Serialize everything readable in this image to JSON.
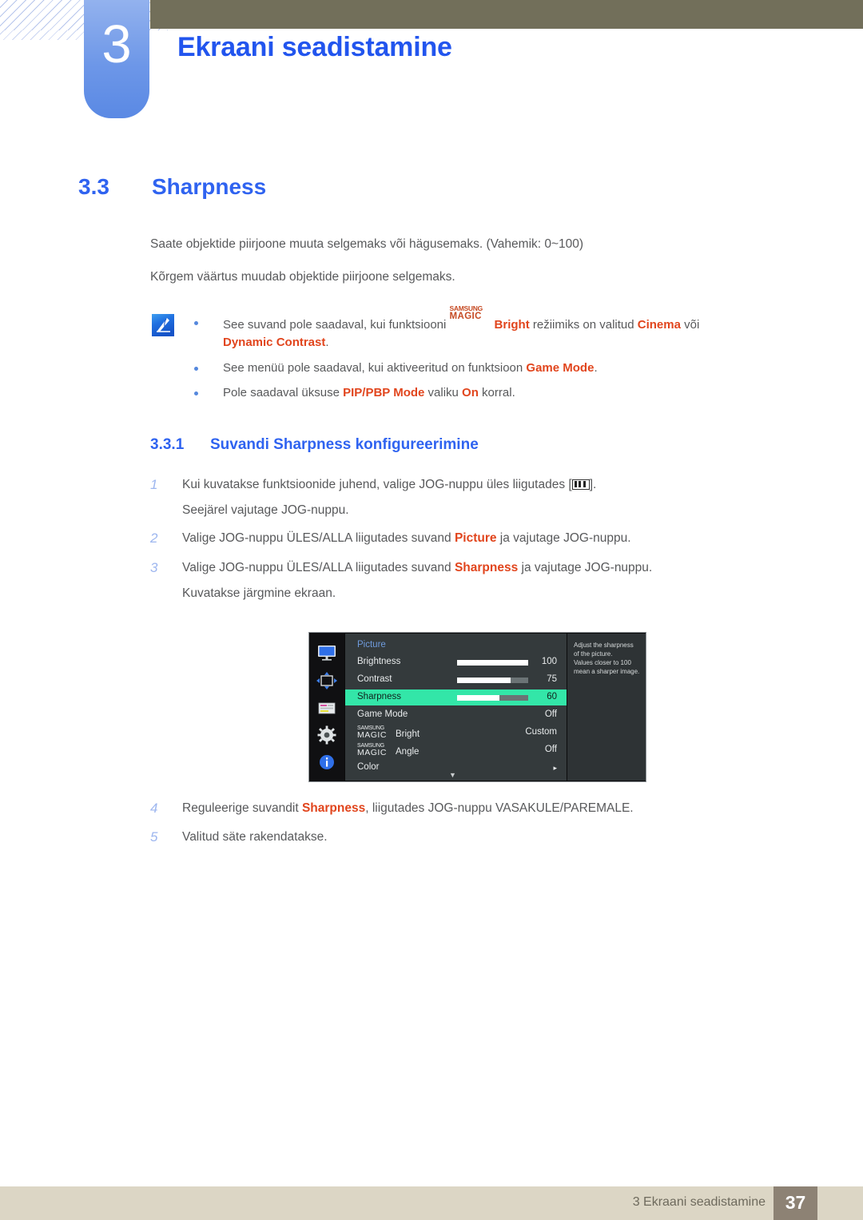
{
  "header": {
    "chapter_number": "3",
    "chapter_title": "Ekraani seadistamine"
  },
  "section": {
    "number": "3.3",
    "title": "Sharpness"
  },
  "intro": {
    "paragraph1": "Saate objektide piirjoone muuta selgemaks või hägusemaks. (Vahemik: 0~100)",
    "paragraph2": "Kõrgem väärtus muudab objektide piirjoone selgemaks."
  },
  "notes": [
    {
      "prefix": "See suvand pole saadaval, kui funktsiooni ",
      "magic_top": "SAMSUNG",
      "magic_bottom": "MAGIC",
      "magic_suffix": "Bright",
      "middle": " režiimiks on valitud ",
      "emphasis1": "Cinema",
      "conj": " või",
      "line2_emphasis": "Dynamic Contrast",
      "line2_tail": "."
    },
    {
      "prefix": "See menüü pole saadaval, kui aktiveeritud on funktsioon ",
      "emphasis1": "Game Mode",
      "tail": "."
    },
    {
      "prefix": "Pole saadaval üksuse ",
      "emphasis1": "PIP/PBP Mode",
      "middle": " valiku ",
      "emphasis2": "On",
      "tail": " korral."
    }
  ],
  "subsection": {
    "number": "3.3.1",
    "title": "Suvandi Sharpness konfigureerimine"
  },
  "steps": [
    {
      "num": "1",
      "text_before": "Kui kuvatakse funktsioonide juhend, valige JOG-nuppu üles liigutades [",
      "icon": "jog-up-icon",
      "text_after": "].",
      "sub": "Seejärel vajutage JOG-nuppu."
    },
    {
      "num": "2",
      "text_before": "Valige JOG-nuppu ÜLES/ALLA liigutades suvand ",
      "emphasis": "Picture",
      "text_after": " ja vajutage JOG-nuppu."
    },
    {
      "num": "3",
      "text_before": "Valige JOG-nuppu ÜLES/ALLA liigutades suvand ",
      "emphasis": "Sharpness",
      "text_after": " ja vajutage JOG-nuppu.",
      "sub": "Kuvatakse järgmine ekraan."
    },
    {
      "num": "4",
      "text_before": "Reguleerige suvandit ",
      "emphasis": "Sharpness",
      "text_after": ", liigutades JOG-nuppu VASAKULE/PAREMALE."
    },
    {
      "num": "5",
      "text_before": "Valitud säte rakendatakse."
    }
  ],
  "osd": {
    "title": "Picture",
    "rail_icons": [
      "monitor-icon",
      "screen-adjust-icon",
      "pip-icon",
      "gear-icon",
      "info-icon"
    ],
    "rows": [
      {
        "label": "Brightness",
        "value": "100",
        "bar_percent": 100,
        "selected": false,
        "type": "slider"
      },
      {
        "label": "Contrast",
        "value": "75",
        "bar_percent": 75,
        "selected": false,
        "type": "slider"
      },
      {
        "label": "Sharpness",
        "value": "60",
        "bar_percent": 60,
        "selected": true,
        "type": "slider"
      },
      {
        "label": "Game Mode",
        "value": "Off",
        "selected": false,
        "type": "value"
      },
      {
        "label_magic_top": "SAMSUNG",
        "label_magic_bottom": "MAGIC",
        "label_magic_suffix": "Bright",
        "value": "Custom",
        "selected": false,
        "type": "magic"
      },
      {
        "label_magic_top": "SAMSUNG",
        "label_magic_bottom": "MAGIC",
        "label_magic_suffix": "Angle",
        "value": "Off",
        "selected": false,
        "type": "magic"
      },
      {
        "label": "Color",
        "value": "▸",
        "selected": false,
        "type": "submenu"
      }
    ],
    "scroll_down_indicator": "▼",
    "help_lines": [
      "Adjust the sharpness",
      "of the picture.",
      "Values closer to 100",
      "mean a sharper image."
    ]
  },
  "footer": {
    "text": "3 Ekraani seadistamine",
    "page": "37"
  },
  "colors": {
    "heading_blue": "#2f63f0",
    "chapter_blue": "#2255ee",
    "emphasis_orange": "#e1451d",
    "olive": "#726f5a",
    "footer_tan": "#dcd6c5",
    "footer_page_brown": "#8d8274",
    "osd_highlight_green": "#33e6a8"
  }
}
